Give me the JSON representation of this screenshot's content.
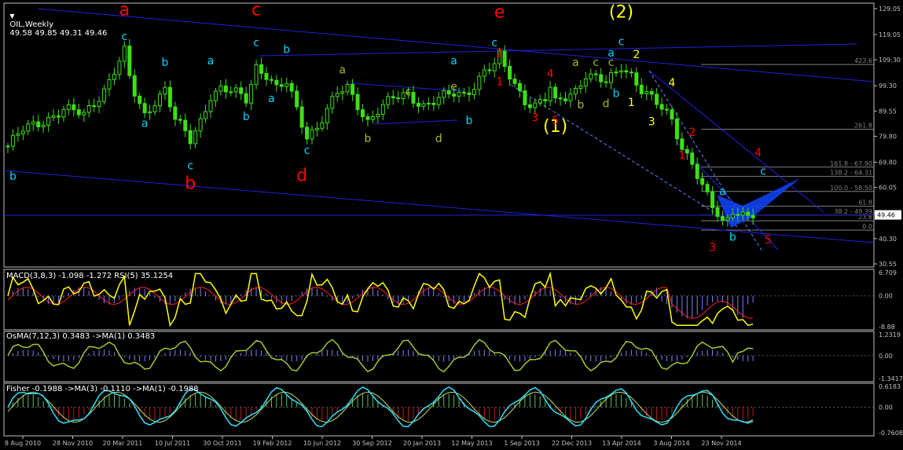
{
  "header": {
    "symbol": "OIL,Weekly",
    "ohlc": "49.58 49.85 49.31 49.46"
  },
  "colors": {
    "background": "#000000",
    "grid_axis": "#c0c0c0",
    "candle": "#3ce014",
    "channel": "#2020e0",
    "wave_red": "#ff0000",
    "wave_cyan": "#00d2ff",
    "wave_yellow": "#ffff00",
    "wave_olive": "#a8b830",
    "macd_line": "#ffff00",
    "macd_signal": "#ff2020",
    "histogram": "#8080ff",
    "osma_line": "#a0c830",
    "fisher_line": "#30e0ff",
    "fisher_signal": "#c0e060",
    "fisher_hist_pos": "#60c060",
    "fisher_hist_neg": "#c02020",
    "fib": "#808080",
    "harmonic_fill": "#1040f0"
  },
  "chart_data": [
    {
      "type": "candlestick",
      "title": "OIL,Weekly",
      "ylim": [
        30.55,
        129.05
      ],
      "y_ticks": [
        "129.05",
        "119.05",
        "109.30",
        "99.30",
        "89.55",
        "79.80",
        "69.80",
        "60.05",
        "50.30",
        "40.30",
        "30.55"
      ],
      "last_price": "49.46",
      "x_ticks": [
        "8 Aug 2010",
        "28 Nov 2010",
        "20 Mar 2011",
        "10 Jul 2011",
        "30 Oct 2011",
        "19 Feb 2012",
        "10 Jun 2012",
        "30 Sep 2012",
        "20 Jan 2013",
        "12 May 2013",
        "1 Sep 2013",
        "22 Dec 2013",
        "13 Apr 2014",
        "3 Aug 2014",
        "23 Nov 2014"
      ],
      "fib_levels": [
        {
          "label": "423.6",
          "value": 107.5
        },
        {
          "label": "261.8",
          "value": 82.5
        },
        {
          "label": "161.8 - 67.90",
          "value": 67.9
        },
        {
          "label": "138.2 - 64.31",
          "value": 64.31
        },
        {
          "label": "100.0 - 58.50",
          "value": 58.5
        },
        {
          "label": "61.8",
          "value": 52.8
        },
        {
          "label": "38.2 - 49.39",
          "value": 49.39
        },
        {
          "label": "23.6",
          "value": 47.2
        },
        {
          "label": "0.0",
          "value": 43.6
        }
      ],
      "wave_labels": [
        {
          "text": "a",
          "color": "red",
          "big": true,
          "t": 23,
          "p": 126.5
        },
        {
          "text": "c",
          "color": "red",
          "big": true,
          "t": 49,
          "p": 126.5
        },
        {
          "text": "e",
          "color": "red",
          "big": true,
          "t": 97,
          "p": 125.5
        },
        {
          "text": "b",
          "color": "red",
          "big": true,
          "t": 36,
          "p": 59.5
        },
        {
          "text": "d",
          "color": "red",
          "big": true,
          "t": 58,
          "p": 62.5
        },
        {
          "text": "(2)",
          "color": "yellow",
          "big": true,
          "t": 121,
          "p": 125.5
        },
        {
          "text": "(1)",
          "color": "yellow",
          "big": true,
          "t": 108,
          "p": 81.5
        },
        {
          "text": "c",
          "color": "cyan",
          "t": 23,
          "p": 117.0
        },
        {
          "text": "b",
          "color": "cyan",
          "t": 31,
          "p": 107.0
        },
        {
          "text": "a",
          "color": "cyan",
          "t": 27,
          "p": 83.5
        },
        {
          "text": "a",
          "color": "cyan",
          "t": 40,
          "p": 107.5
        },
        {
          "text": "c",
          "color": "cyan",
          "t": 36,
          "p": 67.0
        },
        {
          "text": "b",
          "color": "cyan",
          "t": 47,
          "p": 86.0
        },
        {
          "text": "c",
          "color": "cyan",
          "t": 49,
          "p": 114.5
        },
        {
          "text": "b",
          "color": "cyan",
          "t": 55,
          "p": 112.0
        },
        {
          "text": "a",
          "color": "cyan",
          "t": 52,
          "p": 93.0
        },
        {
          "text": "c",
          "color": "cyan",
          "t": 59,
          "p": 73.0
        },
        {
          "text": "a",
          "color": "cyan",
          "t": 88,
          "p": 107.5
        },
        {
          "text": "b",
          "color": "cyan",
          "t": 91,
          "p": 84.5
        },
        {
          "text": "c",
          "color": "cyan",
          "t": 96,
          "p": 114.5
        },
        {
          "text": "c",
          "color": "cyan",
          "t": 121,
          "p": 115.0
        },
        {
          "text": "a",
          "color": "cyan",
          "t": 119,
          "p": 110.5
        },
        {
          "text": "b",
          "color": "cyan",
          "t": 120,
          "p": 95.0
        },
        {
          "text": "b",
          "color": "cyan",
          "t": 1,
          "p": 63.0
        },
        {
          "text": "a",
          "color": "cyan",
          "t": 141,
          "p": 57.0
        },
        {
          "text": "b",
          "color": "cyan",
          "t": 143,
          "p": 39.5
        },
        {
          "text": "c",
          "color": "cyan",
          "t": 149,
          "p": 65.0
        },
        {
          "text": "a",
          "color": "olive",
          "t": 66,
          "p": 104.0
        },
        {
          "text": "b",
          "color": "olive",
          "t": 71,
          "p": 77.5
        },
        {
          "text": "c",
          "color": "olive",
          "t": 79,
          "p": 95.5
        },
        {
          "text": "d",
          "color": "olive",
          "t": 85,
          "p": 77.5
        },
        {
          "text": "e",
          "color": "olive",
          "t": 88,
          "p": 97.5
        },
        {
          "text": "a",
          "color": "olive",
          "t": 112,
          "p": 107.0
        },
        {
          "text": "c",
          "color": "olive",
          "t": 116,
          "p": 107.0
        },
        {
          "text": "b",
          "color": "olive",
          "t": 113,
          "p": 90.5
        },
        {
          "text": "d",
          "color": "olive",
          "t": 118,
          "p": 91.0
        },
        {
          "text": "c",
          "color": "olive",
          "t": 119,
          "p": 107.0
        },
        {
          "text": "2",
          "color": "yellow",
          "t": 124,
          "p": 110.0
        },
        {
          "text": "1",
          "color": "yellow",
          "t": 123,
          "p": 91.5
        },
        {
          "text": "4",
          "color": "yellow",
          "t": 131,
          "p": 99.0
        },
        {
          "text": "3",
          "color": "yellow",
          "t": 127,
          "p": 84.0
        },
        {
          "text": "2",
          "color": "red",
          "t": 97,
          "p": 110.5
        },
        {
          "text": "1",
          "color": "red",
          "t": 97,
          "p": 99.5
        },
        {
          "text": "4",
          "color": "red",
          "t": 107,
          "p": 102.5
        },
        {
          "text": "3",
          "color": "red",
          "t": 104,
          "p": 85.5
        },
        {
          "text": "5",
          "color": "red",
          "t": 108,
          "p": 84.5
        },
        {
          "text": "2",
          "color": "red",
          "t": 135,
          "p": 80.0
        },
        {
          "text": "1",
          "color": "red",
          "t": 133,
          "p": 71.0
        },
        {
          "text": "4",
          "color": "red",
          "t": 148,
          "p": 72.0
        },
        {
          "text": "3",
          "color": "red",
          "t": 139,
          "p": 35.5
        },
        {
          "text": "5",
          "color": "red",
          "t": 150,
          "p": 38.5
        }
      ]
    },
    {
      "type": "line",
      "title": "MACD(3,8,3) -1.098 -1.272 RSI(5) 35.1254",
      "ylim": [
        -8.88,
        6.709
      ],
      "y_ticks": [
        "6.709",
        "0.00",
        "-8.88"
      ]
    },
    {
      "type": "line",
      "title": "OsMA(7,12,3) 0.3483 ->MA(1) 0.3483",
      "ylim": [
        -1.3417,
        1.2319
      ],
      "y_ticks": [
        "1.2319",
        "0.00",
        "-1.3417"
      ]
    },
    {
      "type": "line",
      "title": "Fisher -0.1988 ->MA(3) -0.1110 ->MA(1) -0.1988",
      "ylim": [
        -0.7608,
        0.6183
      ],
      "y_ticks": [
        "0.6183",
        "0.00",
        "-0.7608"
      ]
    }
  ]
}
